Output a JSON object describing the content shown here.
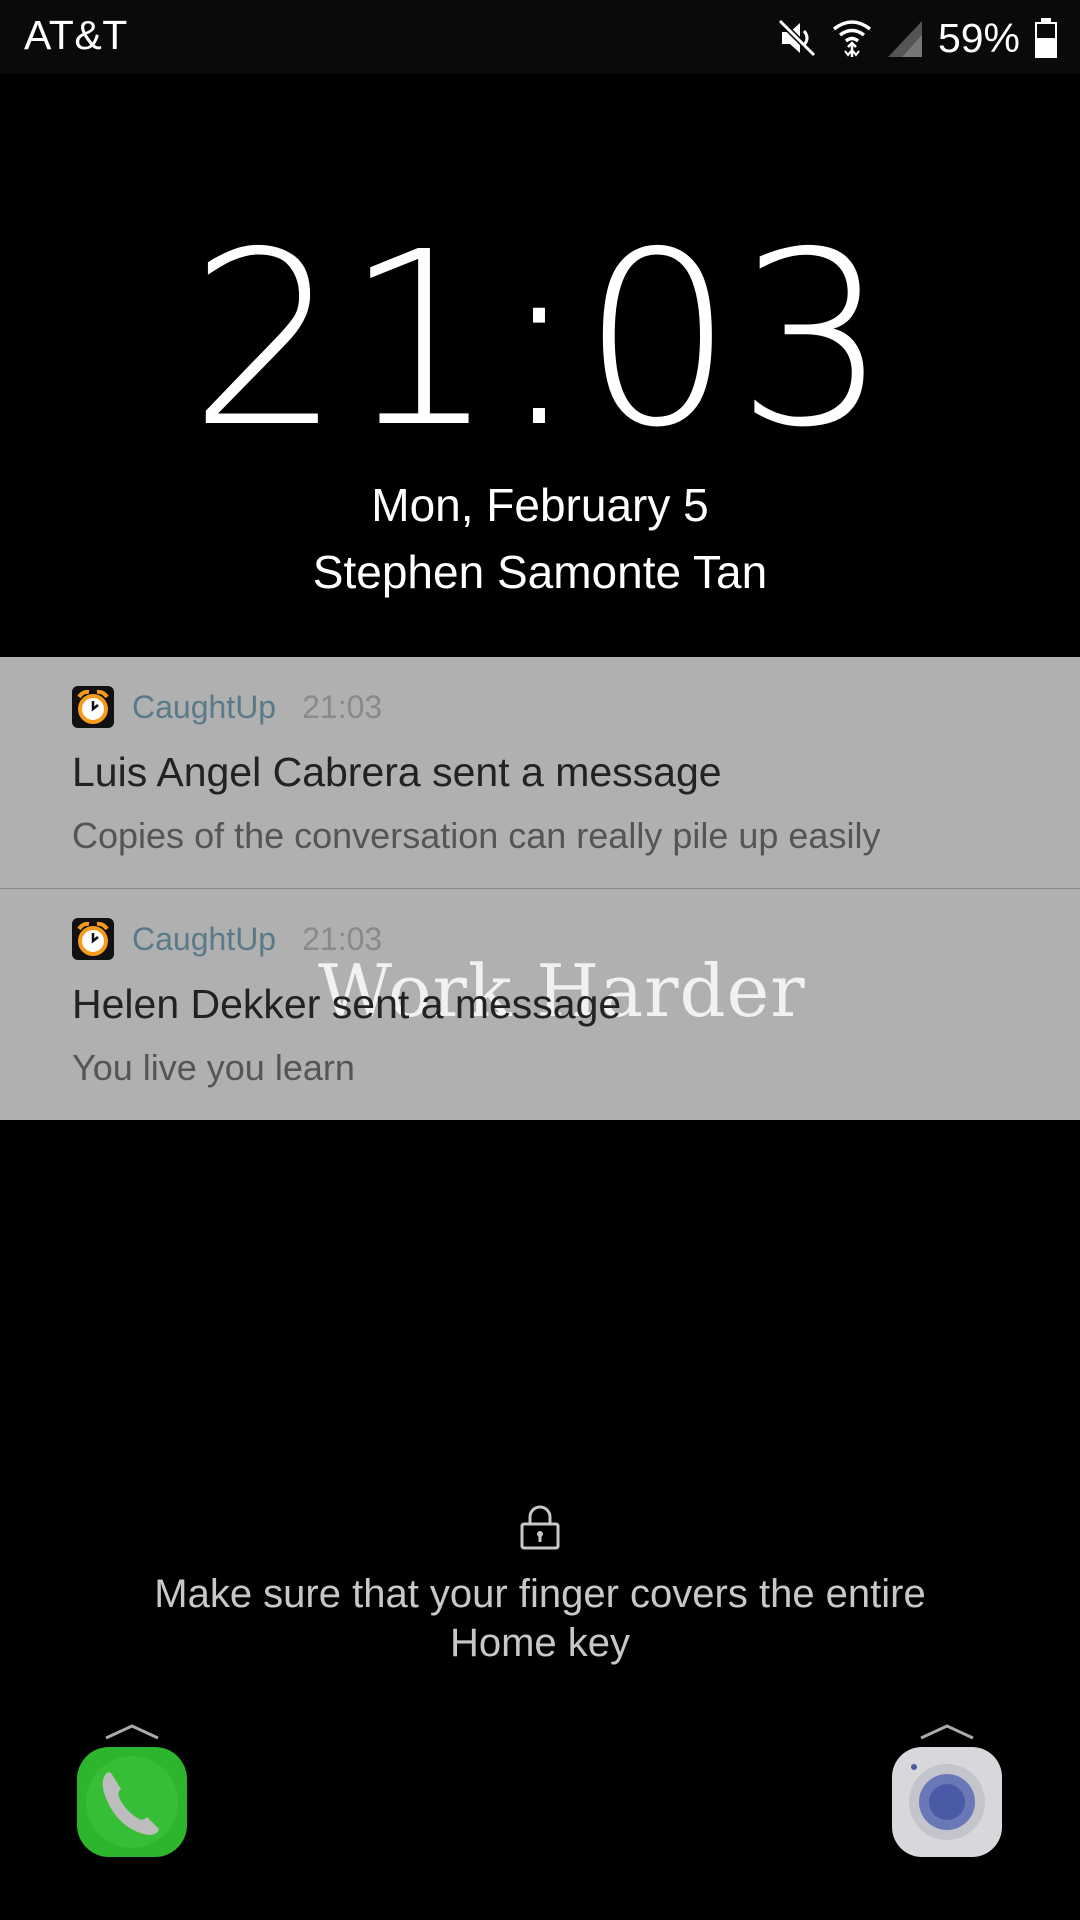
{
  "status_bar": {
    "carrier": "AT&T",
    "battery_percent": "59%",
    "battery_level": 0.59,
    "icons": [
      "mute-icon",
      "wifi-icon",
      "signal-icon",
      "battery-icon"
    ]
  },
  "lockscreen": {
    "time": "21:03",
    "date": "Mon, February 5",
    "owner": "Stephen Samonte Tan"
  },
  "notifications": [
    {
      "app": "CaughtUp",
      "time": "21:03",
      "title": "Luis Angel Cabrera sent a message",
      "body": "Copies of the conversation can really pile up easily",
      "icon": "alarm-clock-icon"
    },
    {
      "app": "CaughtUp",
      "time": "21:03",
      "title": "Helen Dekker sent a message",
      "body": "You live you learn",
      "icon": "alarm-clock-icon",
      "overlay_text": "Work Harder"
    }
  ],
  "unlock": {
    "hint": "Make sure that your finger covers the entire Home key",
    "icon": "lock-icon"
  },
  "shortcuts": {
    "left": "phone-icon",
    "right": "camera-icon"
  },
  "colors": {
    "notification_bg": "#b0b0b0",
    "app_name": "#5a7a8a",
    "phone_green": "#2db52d",
    "camera_gray": "#d8d8dc"
  }
}
